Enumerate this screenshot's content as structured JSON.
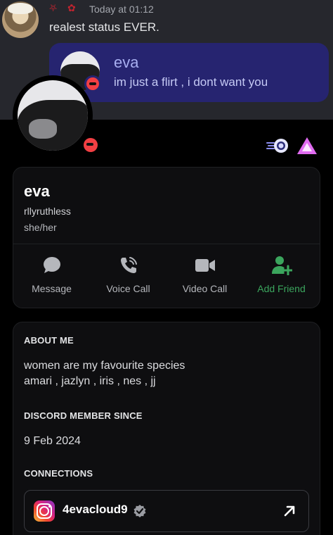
{
  "message": {
    "emoji_1": "⛧",
    "emoji_2": "✿",
    "timestamp": "Today at 01:12",
    "text": "realest status EVER."
  },
  "status_embed": {
    "name": "eva",
    "status_text": "im just a flirt , i dont want you",
    "presence": "dnd"
  },
  "profile": {
    "display_name": "eva",
    "username": "rllyruthless",
    "pronouns": "she/her",
    "presence": "dnd",
    "badges": [
      "nitro-orbit-badge-icon",
      "triangle-badge-icon"
    ],
    "actions": [
      {
        "label": "Message",
        "icon": "chat-bubble-icon"
      },
      {
        "label": "Voice Call",
        "icon": "phone-icon"
      },
      {
        "label": "Video Call",
        "icon": "video-camera-icon"
      },
      {
        "label": "Add Friend",
        "icon": "add-friend-icon",
        "color": "#3ba55d"
      }
    ]
  },
  "about": {
    "about_title": "ABOUT ME",
    "about_line_1": "women are my favourite species",
    "about_line_2": "amari , jazlyn , iris , nes , jj",
    "member_since_title": "DISCORD MEMBER SINCE",
    "member_since": "9 Feb 2024",
    "connections_title": "CONNECTIONS",
    "connections": [
      {
        "service": "instagram",
        "name": "4evacloud9",
        "verified": true
      }
    ]
  },
  "colors": {
    "status_card": "#262470",
    "dnd": "#f23f43",
    "add_friend": "#3ba55d",
    "card_bg": "#0e0e10"
  }
}
